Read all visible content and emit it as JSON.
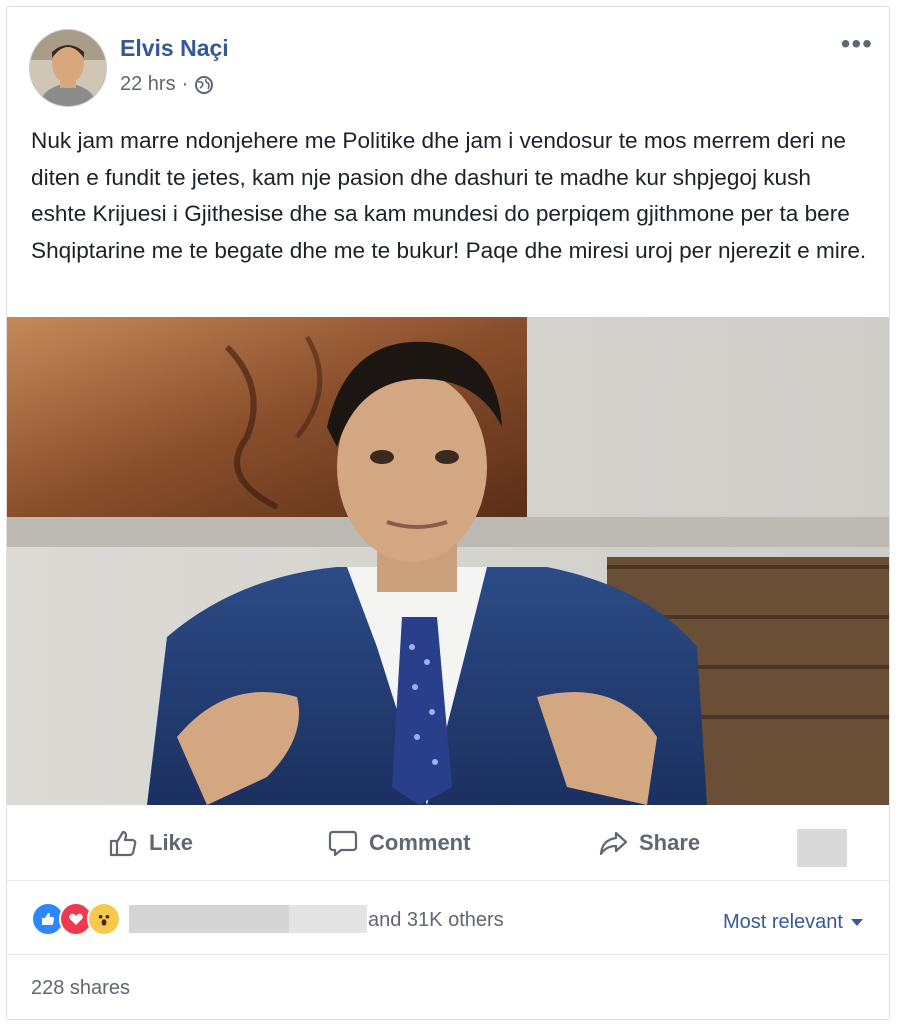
{
  "post": {
    "author": "Elvis Naçi",
    "time": "22 hrs",
    "separator": "·",
    "text": "Nuk jam marre ndonjehere me Politike dhe jam i vendosur te mos merrem deri ne diten e fundit te jetes, kam nje pasion dhe dashuri te madhe kur shpjegoj kush eshte Krijuesi i Gjithesise dhe sa kam mundesi do perpiqem gjithmone per ta bere Shqiptarine me te begate dhe me te bukur! Paqe dhe miresi uroj per njerezit e mire.",
    "more_label": "•••"
  },
  "actions": {
    "like": "Like",
    "comment": "Comment",
    "share": "Share"
  },
  "reactions": {
    "others_text": "and 31K others",
    "sort_label": "Most relevant",
    "icons": [
      "like-reaction-icon",
      "love-reaction-icon",
      "wow-reaction-icon"
    ]
  },
  "footer": {
    "shares": "228 shares"
  },
  "colors": {
    "author": "#365899",
    "meta": "#616770",
    "like_reaction": "#2d88ff",
    "love_reaction": "#f0384e",
    "wow_reaction": "#f7c94b"
  }
}
